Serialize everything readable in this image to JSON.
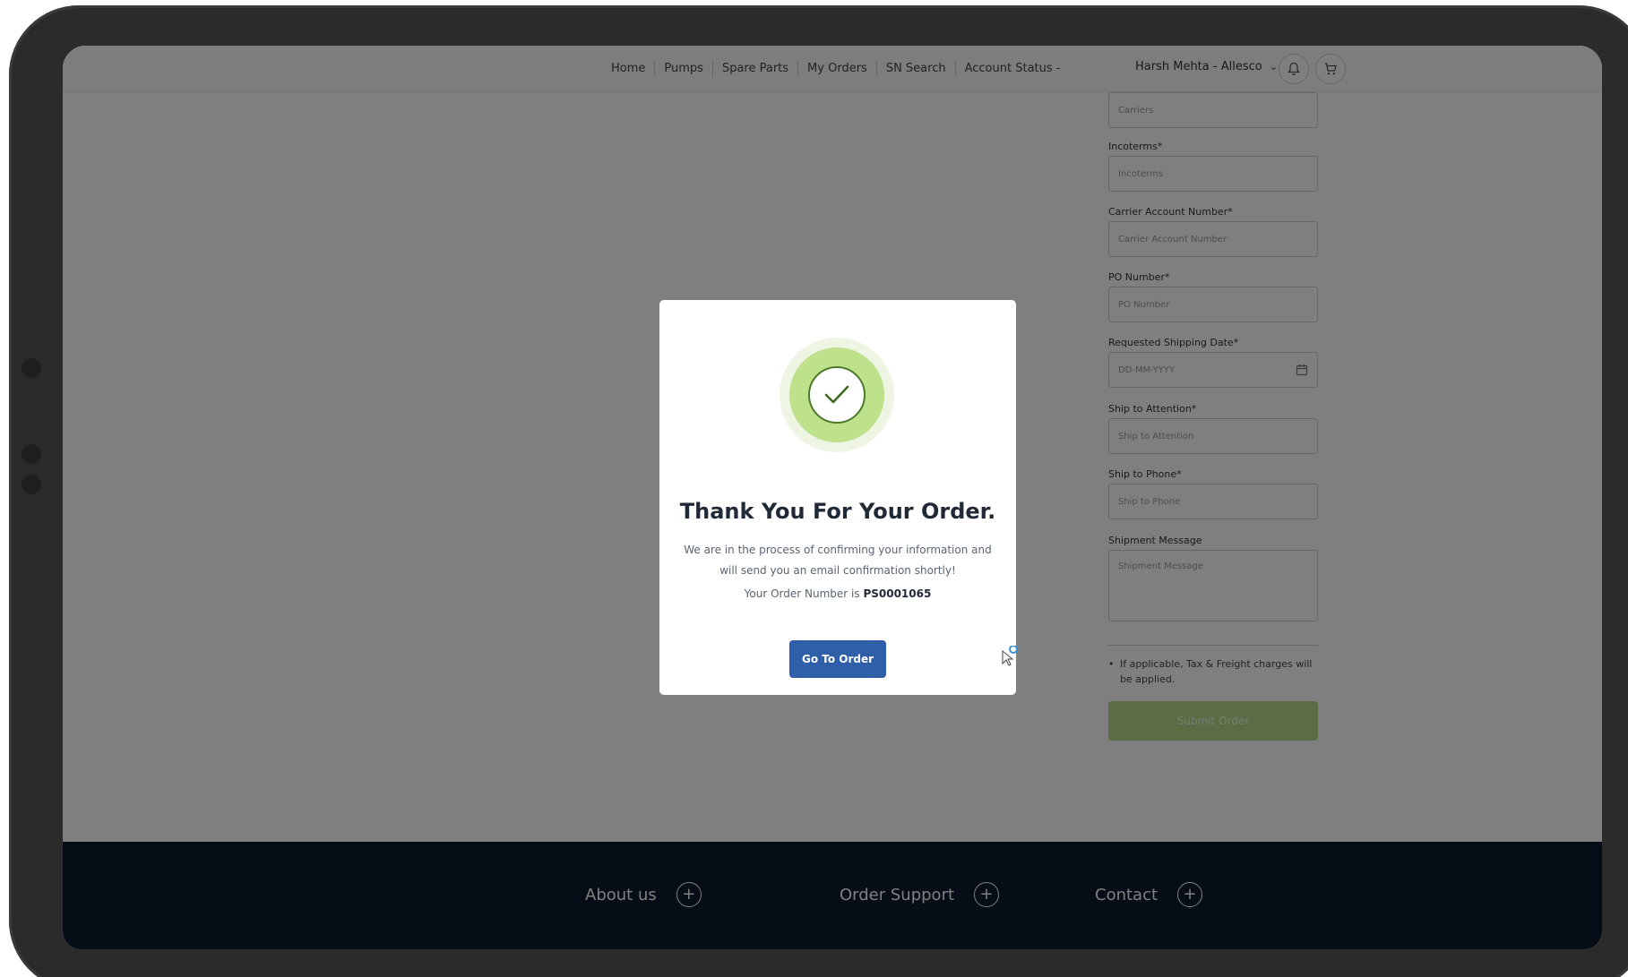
{
  "nav": {
    "links": [
      "Home",
      "Pumps",
      "Spare Parts",
      "My Orders",
      "SN Search",
      "Account Status -"
    ],
    "user_label": "Harsh Mehta - Allesco",
    "user_caret": "⌄"
  },
  "form": {
    "carriers_placeholder": "Carriers",
    "incoterms_label": "Incoterms*",
    "incoterms_placeholder": "Incoterms",
    "carrier_account_label": "Carrier Account Number*",
    "carrier_account_placeholder": "Carrier Account Number",
    "po_label": "PO Number*",
    "po_placeholder": "PO Number",
    "ship_date_label": "Requested Shipping Date*",
    "ship_date_placeholder": "DD-MM-YYYY",
    "ship_attention_label": "Ship to Attention*",
    "ship_attention_placeholder": "Ship to Attention",
    "ship_phone_label": "Ship to Phone*",
    "ship_phone_placeholder": "Ship to Phone",
    "shipment_message_label": "Shipment Message",
    "shipment_message_placeholder": "Shipment Message",
    "note": "If applicable, Tax & Freight charges will be applied.",
    "submit_label": "Submit Order"
  },
  "footer": {
    "about_label": "About us",
    "support_label": "Order Support",
    "contact_label": "Contact",
    "plus": "+"
  },
  "modal": {
    "title": "Thank You For Your Order.",
    "message": "We are in the process of confirming your information and will send you an email confirmation shortly!",
    "order_prefix": "Your Order Number is ",
    "order_number": "PS0001065",
    "button_label": "Go To Order"
  },
  "colors": {
    "footer_bg": "#0f1b2d",
    "primary_button": "#2f5fa8",
    "success_green": "#bde28b",
    "submit_green": "#b9d98a"
  },
  "icons": [
    "bell-icon",
    "cart-icon",
    "calendar-icon",
    "checkmark-icon",
    "plus-icon",
    "cursor-icon"
  ]
}
